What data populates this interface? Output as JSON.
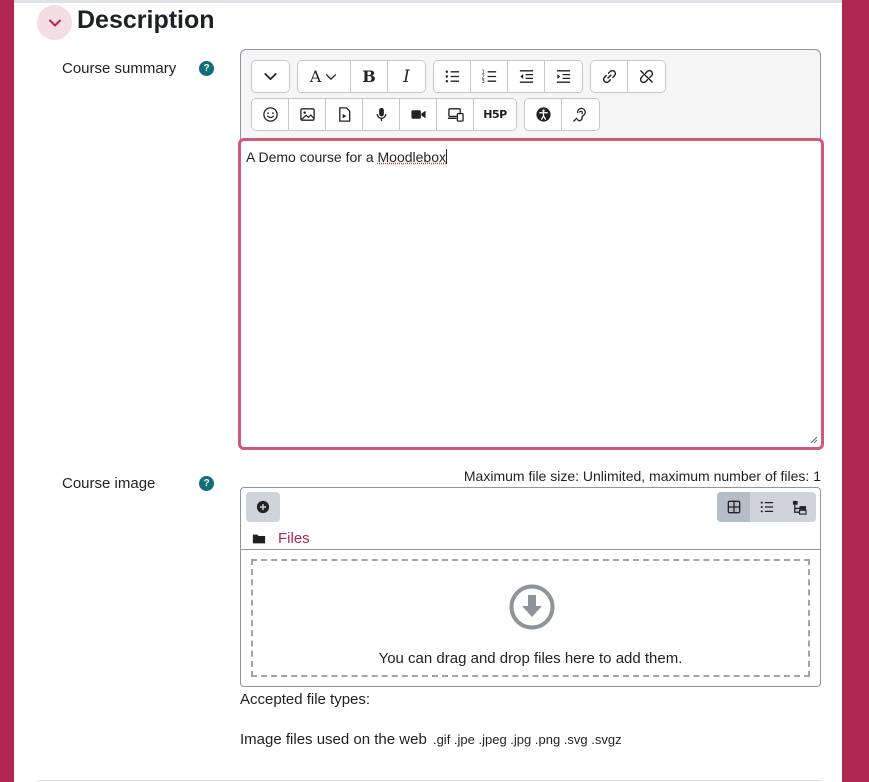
{
  "section": {
    "title": "Description",
    "toggle_icon": "chevron-down-icon"
  },
  "course_summary": {
    "label": "Course summary",
    "help_glyph": "?",
    "content_prefix": "A Demo course for a ",
    "content_misspelled": "Moodlebox"
  },
  "toolbar": {
    "row1": [
      "chevron-down-icon",
      "font-style-icon",
      "bold-icon",
      "italic-icon",
      "bullet-list-icon",
      "numbered-list-icon",
      "outdent-icon",
      "indent-icon",
      "link-icon",
      "unlink-icon"
    ],
    "row2": [
      "emoji-icon",
      "image-icon",
      "media-icon",
      "record-audio-icon",
      "record-video-icon",
      "manage-files-icon",
      "h5p-icon",
      "accessibility-checker-icon",
      "screenreader-helper-icon"
    ],
    "h5p_label": "H5P",
    "bold_label": "B",
    "italic_label": "I",
    "font_label": "A"
  },
  "course_image": {
    "label": "Course image",
    "help_glyph": "?",
    "max_size_text": "Maximum file size: Unlimited, maximum number of files: 1",
    "path_label": "Files",
    "drop_text": "You can drag and drop files here to add them.",
    "accepted_label": "Accepted file types:",
    "accepted_group": "Image files used on the web",
    "accepted_ext": ".gif .jpe .jpeg .jpg .png .svg .svgz"
  },
  "colors": {
    "brand": "#b0274f",
    "focus_border": "#d2587a",
    "help_icon": "#0f6e7a"
  }
}
